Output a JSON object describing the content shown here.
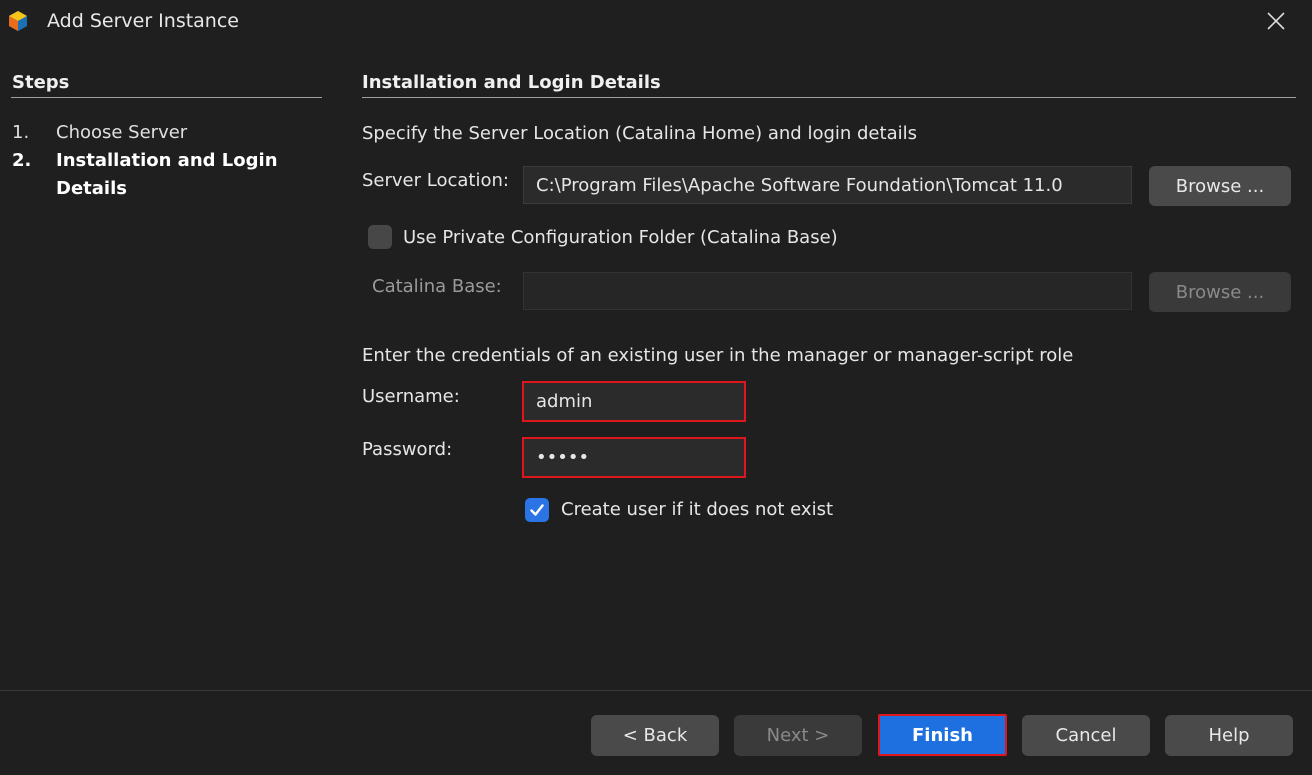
{
  "window": {
    "title": "Add Server Instance"
  },
  "steps": {
    "heading": "Steps",
    "items": [
      {
        "num": "1.",
        "label": "Choose Server"
      },
      {
        "num": "2.",
        "label": "Installation and Login Details"
      }
    ]
  },
  "main": {
    "heading": "Installation and Login Details",
    "intro": "Specify the Server Location (Catalina Home) and login details",
    "server_location_label": "Server Location:",
    "server_location_value": "C:\\Program Files\\Apache Software Foundation\\Tomcat 11.0",
    "browse_label": "Browse ...",
    "private_config_label": "Use Private Configuration Folder (Catalina Base)",
    "private_config_checked": false,
    "catalina_base_label": "Catalina Base:",
    "catalina_base_value": "",
    "browse_disabled_label": "Browse ...",
    "credentials_intro": "Enter the credentials of an existing user in the manager or manager-script role",
    "username_label": "Username:",
    "username_value": "admin",
    "password_label": "Password:",
    "password_value": "•••••",
    "create_user_label": "Create user if it does not exist",
    "create_user_checked": true
  },
  "footer": {
    "back_label": "< Back",
    "next_label": "Next >",
    "finish_label": "Finish",
    "cancel_label": "Cancel",
    "help_label": "Help"
  },
  "colors": {
    "background": "#1f1f1f",
    "accent": "#1e6fe0",
    "highlight": "#e0161f"
  }
}
